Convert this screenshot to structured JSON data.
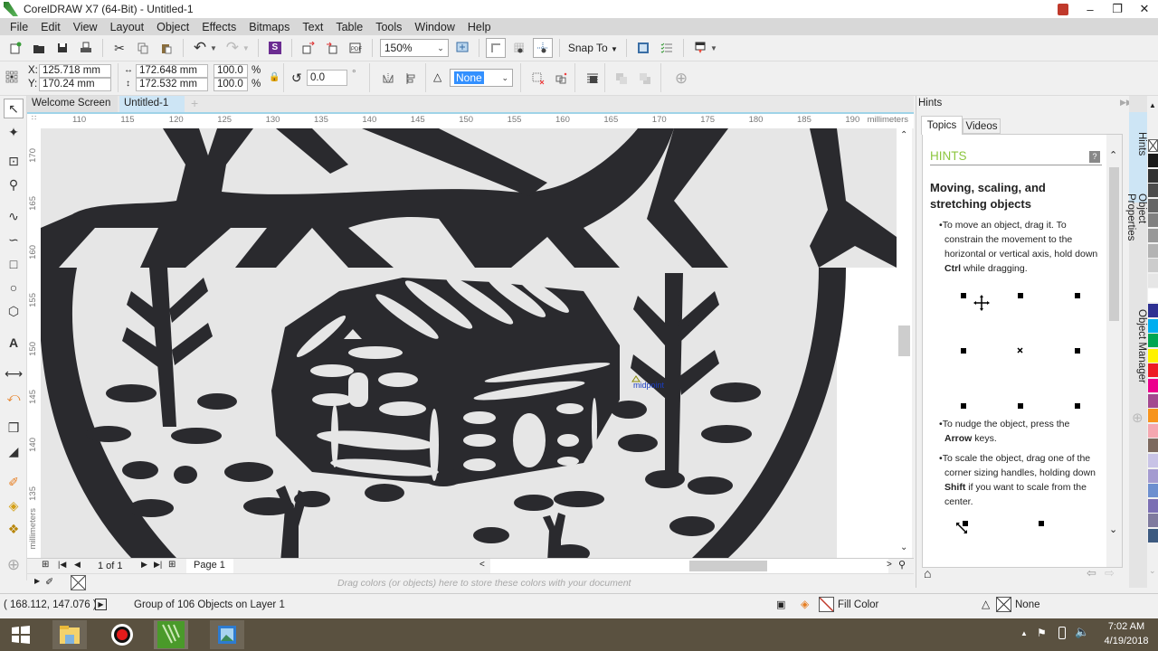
{
  "window": {
    "title": "CorelDRAW X7 (64-Bit) - Untitled-1",
    "controls": [
      "user",
      "minimize",
      "restore",
      "close"
    ]
  },
  "menubar": {
    "items": [
      "File",
      "Edit",
      "View",
      "Layout",
      "Object",
      "Effects",
      "Bitmaps",
      "Text",
      "Table",
      "Tools",
      "Window",
      "Help"
    ]
  },
  "standard_toolbar": {
    "icons": [
      "new-icon",
      "open-icon",
      "save-icon",
      "print-icon",
      "cut-icon",
      "copy-icon",
      "paste-icon",
      "undo-icon",
      "redo-icon",
      "search-content-icon",
      "import-icon",
      "export-icon",
      "publish-pdf-icon"
    ],
    "zoom_level": "150%",
    "snap_to_label": "Snap To"
  },
  "property_bar": {
    "x_label": "X:",
    "x_value": "125.718 mm",
    "y_label": "Y:",
    "y_value": "170.24 mm",
    "width_value": "172.648 mm",
    "height_value": "172.532 mm",
    "scale_w": "100.0",
    "scale_h": "100.0",
    "percent": "%",
    "rotation_value": "0.0",
    "degree": "°",
    "outline_value": "None"
  },
  "document_tabs": {
    "tabs": [
      "Welcome Screen",
      "Untitled-1"
    ],
    "active": "Untitled-1"
  },
  "rulers": {
    "horizontal_ticks": [
      "110",
      "115",
      "120",
      "125",
      "130",
      "135",
      "140",
      "145",
      "150",
      "155",
      "160",
      "165",
      "170",
      "175",
      "180",
      "185",
      "190"
    ],
    "horizontal_unit": "millimeters",
    "vertical_ticks": [
      "170",
      "165",
      "160",
      "155",
      "150",
      "145",
      "140",
      "135"
    ],
    "vertical_unit": "millimeters"
  },
  "canvas": {
    "snap_label": "midpoint"
  },
  "page_nav": {
    "page_count": "1 of 1",
    "page_tab": "Page 1"
  },
  "document_palette": {
    "hint": "Drag colors (or objects) here to store these colors with your document"
  },
  "status": {
    "coordinates": "( 168.112, 147.076 )",
    "object_info": "Group of 106 Objects on Layer 1",
    "fill_label": "Fill Color",
    "outline_label": "None"
  },
  "docker": {
    "title": "Hints",
    "tabs": [
      "Topics",
      "Videos"
    ],
    "active_tab": "Topics",
    "heading": "HINTS",
    "topic_title": "Moving, scaling, and stretching objects",
    "paragraphs": [
      {
        "before": "To move an object, drag it. To constrain the movement to the horizontal or vertical axis, hold down ",
        "bold": "Ctrl",
        "after": " while dragging."
      },
      {
        "before": "To nudge the object, press the ",
        "bold": "Arrow",
        "after": " keys."
      },
      {
        "before": "To scale the object, drag one of the corner sizing handles, holding down ",
        "bold": "Shift",
        "after": " if you want to scale from the center."
      }
    ]
  },
  "docker_side_tabs": [
    "Hints",
    "Object Properties",
    "Object Manager"
  ],
  "color_palette": [
    "#1a1a1a",
    "#333333",
    "#4d4d4d",
    "#666666",
    "#808080",
    "#999999",
    "#b3b3b3",
    "#cccccc",
    "#e6e6e6",
    "#ffffff",
    "#2e3192",
    "#00aeef",
    "#00a651",
    "#fff200",
    "#ed1c24",
    "#ec008c",
    "#a3498f",
    "#f7941d",
    "#f5a7b0",
    "#7d6a5f",
    "#c8c3e6",
    "#a49bd0",
    "#6d8fcf",
    "#7b6fb3",
    "#7f7a9e",
    "#3d5a80"
  ],
  "taskbar": {
    "time": "7:02 AM",
    "date": "4/19/2018",
    "apps": [
      "file-explorer",
      "recorder",
      "coreldraw",
      "photo-viewer"
    ]
  }
}
